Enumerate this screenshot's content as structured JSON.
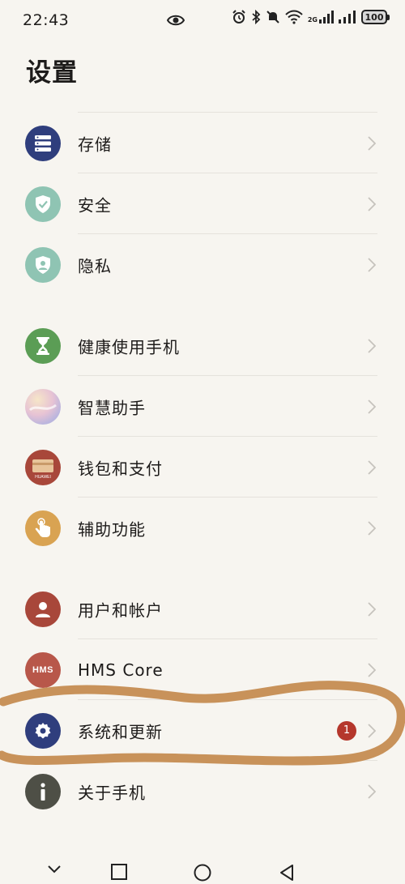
{
  "status_bar": {
    "time": "22:43",
    "network_label": "2G",
    "battery": "100",
    "icons": [
      "eye-icon",
      "alarm-icon",
      "bluetooth-icon",
      "mute-icon",
      "wifi-icon",
      "signal-icon",
      "battery-icon"
    ]
  },
  "page": {
    "title": "设置"
  },
  "groups": [
    {
      "items": [
        {
          "label": "存储",
          "icon": "storage-icon",
          "color": "#2f3e7d"
        },
        {
          "label": "安全",
          "icon": "shield-check-icon",
          "color": "#8fc4b3"
        },
        {
          "label": "隐私",
          "icon": "privacy-shield-icon",
          "color": "#8fc4b3"
        }
      ]
    },
    {
      "items": [
        {
          "label": "健康使用手机",
          "icon": "hourglass-icon",
          "color": "#5b9d55"
        },
        {
          "label": "智慧助手",
          "icon": "assistant-icon",
          "color": "#d9b2c8"
        },
        {
          "label": "钱包和支付",
          "icon": "wallet-icon",
          "color": "#a8473a"
        },
        {
          "label": "辅助功能",
          "icon": "hand-pointer-icon",
          "color": "#d9a352"
        }
      ]
    },
    {
      "items": [
        {
          "label": "用户和帐户",
          "icon": "user-icon",
          "color": "#a8473a"
        },
        {
          "label": "HMS Core",
          "icon": "hms-icon",
          "color": "#b8574a",
          "icon_text": "HMS"
        },
        {
          "label": "系统和更新",
          "icon": "gear-icon",
          "color": "#2f3e7d",
          "badge": "1"
        },
        {
          "label": "关于手机",
          "icon": "info-icon",
          "color": "#4e4f46"
        }
      ]
    }
  ],
  "wallet_icon_text": "HUAWEI",
  "highlight_color": "#c8925a",
  "nav_bar": {
    "buttons": [
      "back-chevron-icon",
      "recent-apps-icon",
      "home-icon",
      "back-icon"
    ]
  }
}
